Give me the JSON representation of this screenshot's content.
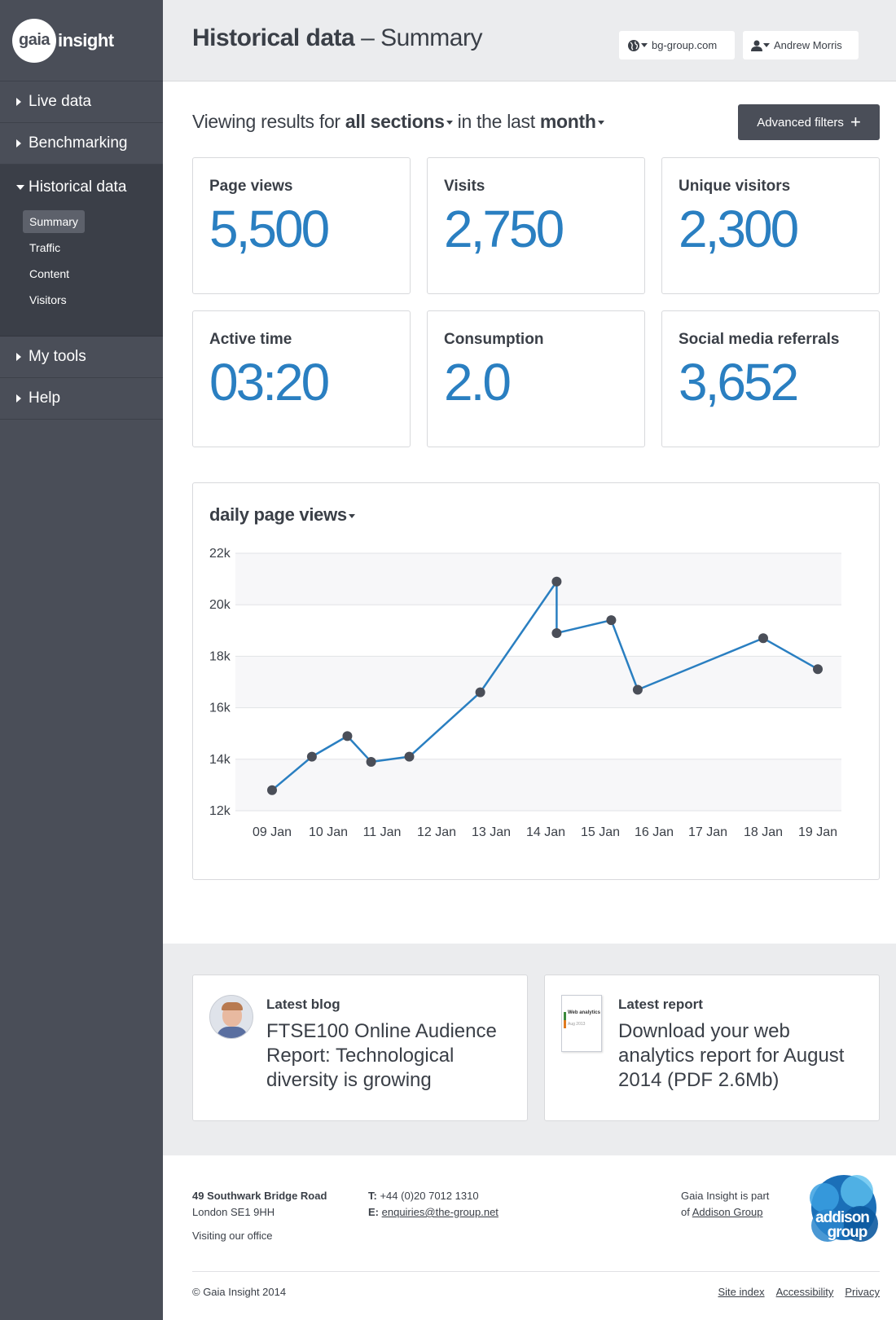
{
  "brand": {
    "logo_circle": "gaia",
    "logo_text": "insight"
  },
  "nav": {
    "live": "Live data",
    "benchmarking": "Benchmarking",
    "historical": "Historical data",
    "sub": [
      "Summary",
      "Traffic",
      "Content",
      "Visitors"
    ],
    "tools": "My tools",
    "help": "Help"
  },
  "header": {
    "title_bold": "Historical data",
    "title_sep": " – ",
    "title_sub": "Summary",
    "domain": "bg-group.com",
    "user": "Andrew Morris"
  },
  "filter": {
    "prefix": "Viewing results for ",
    "section": "all sections",
    "middle": " in the last ",
    "period": "month",
    "advanced": "Advanced filters"
  },
  "stats": [
    {
      "label": "Page views",
      "value": "5,500"
    },
    {
      "label": "Visits",
      "value": "2,750"
    },
    {
      "label": "Unique visitors",
      "value": "2,300"
    },
    {
      "label": "Active time",
      "value": "03:20"
    },
    {
      "label": "Consumption",
      "value": "2.0"
    },
    {
      "label": "Social media referrals",
      "value": "3,652"
    }
  ],
  "chart_title": "daily page views",
  "chart_data": {
    "type": "line",
    "title": "daily page views",
    "x": [
      "09 Jan",
      "10 Jan",
      "11 Jan",
      "12 Jan",
      "13 Jan",
      "14 Jan",
      "15 Jan",
      "16 Jan",
      "17 Jan",
      "18 Jan",
      "19 Jan"
    ],
    "y_ticks": [
      "22k",
      "20k",
      "18k",
      "16k",
      "14k",
      "12k"
    ],
    "ylim": [
      12000,
      22000
    ],
    "series": [
      {
        "points": [
          [
            "09 Jan",
            12800
          ],
          [
            "10 Jan",
            14100
          ],
          [
            "10 Jan",
            14900
          ],
          [
            "11 Jan",
            13900
          ],
          [
            "12 Jan",
            14100
          ],
          [
            "13 Jan",
            16600
          ],
          [
            "14 Jan",
            20900
          ],
          [
            "14 Jan",
            18900
          ],
          [
            "15 Jan",
            19400
          ],
          [
            "16 Jan",
            16700
          ],
          [
            "18 Jan",
            18700
          ],
          [
            "19 Jan",
            17500
          ]
        ]
      }
    ],
    "color": "#2a7fc1",
    "grid": true
  },
  "promos": {
    "blog_title": "Latest blog",
    "blog_text": "FTSE100 Online Audience Report: Technological diversity is growing",
    "report_title": "Latest report",
    "report_text": "Download your web analytics report for August 2014 (PDF 2.6Mb)",
    "report_thumb_title": "Web analytics",
    "report_thumb_sub": "Aug 2013"
  },
  "footer": {
    "addr1": "49 Southwark Bridge Road",
    "addr2": "London SE1 9HH",
    "visit": "Visiting our office",
    "t_label": "T:",
    "phone": "+44 (0)20 7012 1310",
    "e_label": "E:",
    "email": "enquiries@the-group.net",
    "part1": "Gaia Insight is part",
    "part2_prefix": "of ",
    "part2_link": "Addison Group",
    "addison_logo": "addison group",
    "copyright": "© Gaia Insight 2014",
    "links": [
      "Site index",
      "Accessibility",
      "Privacy"
    ]
  },
  "colors": {
    "accent": "#2a7fc1",
    "sidebar": "#4a4e58",
    "header_bg": "#ebecee"
  }
}
